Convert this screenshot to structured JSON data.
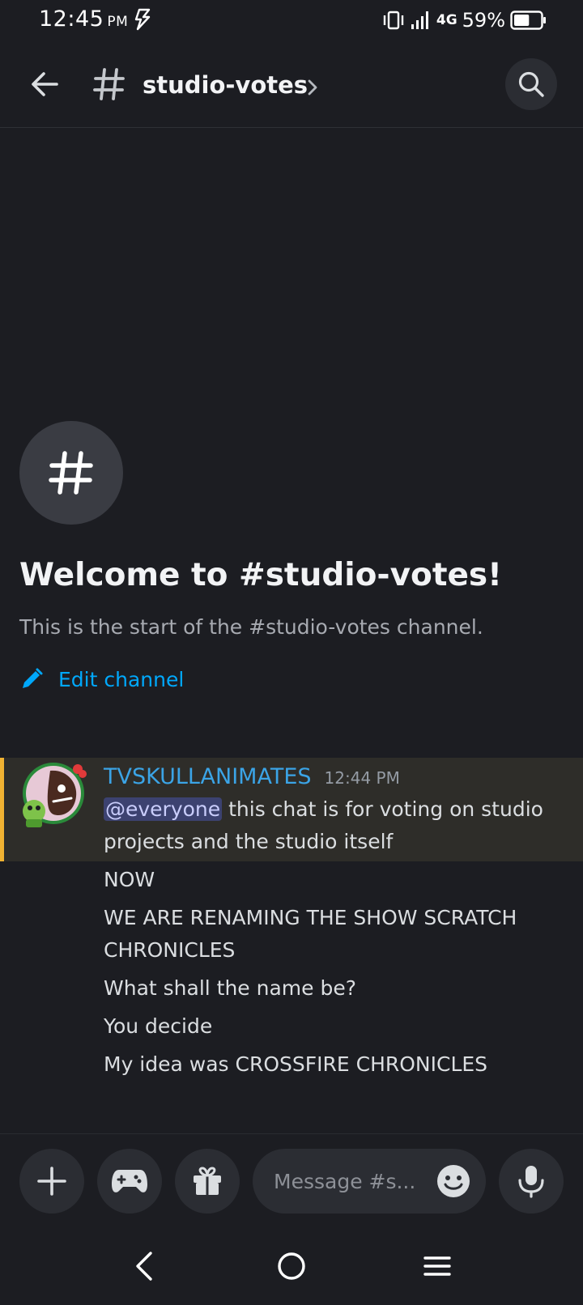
{
  "status_bar": {
    "time": "12:45",
    "ampm": "PM",
    "network": "4G",
    "battery": "59%",
    "battery_level": 0.59
  },
  "header": {
    "channel_name": "studio-votes"
  },
  "welcome": {
    "title": "Welcome to #studio-votes!",
    "subtitle": "This is the start of the #studio-votes channel.",
    "edit_label": "Edit channel"
  },
  "messages": {
    "author": "TVSKULLANIMATES",
    "timestamp": "12:44 PM",
    "mention": "@everyone",
    "line1": " this chat is for voting on studio",
    "line1b": "projects and the studio itself",
    "line2": "NOW",
    "line3a": "WE ARE RENAMING THE SHOW SCRATCH",
    "line3b": "CHRONICLES",
    "line4": "What shall the name be?",
    "line5": "You decide",
    "line6": "My idea was CROSSFIRE CHRONICLES"
  },
  "composer": {
    "placeholder": "Message #s..."
  },
  "colors": {
    "background": "#1c1d22",
    "accent": "#00a8fc",
    "mention_highlight": "#f0b232",
    "author": "#3ba4e6"
  }
}
